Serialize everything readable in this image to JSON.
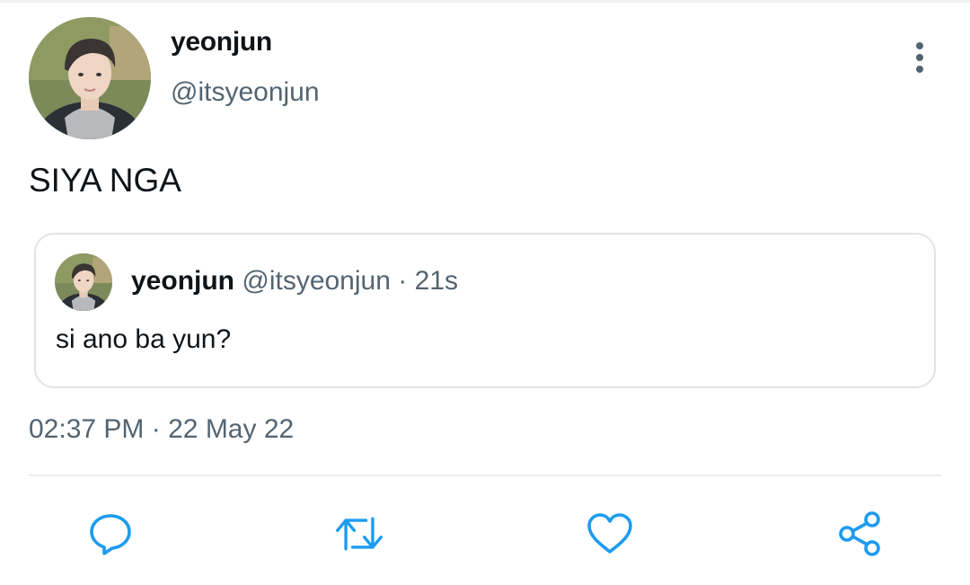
{
  "tweet": {
    "display_name": "yeonjun",
    "handle": "@itsyeonjun",
    "text": "SIYA NGA",
    "time": "02:37 PM",
    "separator": "·",
    "date": "22 May 22"
  },
  "quoted_tweet": {
    "display_name": "yeonjun",
    "handle": "@itsyeonjun",
    "separator": "·",
    "relative_time": "21s",
    "text": "si ano ba yun?"
  },
  "icons": {
    "more": "more-vertical-icon",
    "reply": "reply-icon",
    "retweet": "retweet-icon",
    "like": "heart-icon",
    "share": "share-icon"
  },
  "colors": {
    "text_primary": "#0f1419",
    "text_secondary": "#536471",
    "border": "#dfe4e8",
    "icon": "#1d9bf0"
  }
}
